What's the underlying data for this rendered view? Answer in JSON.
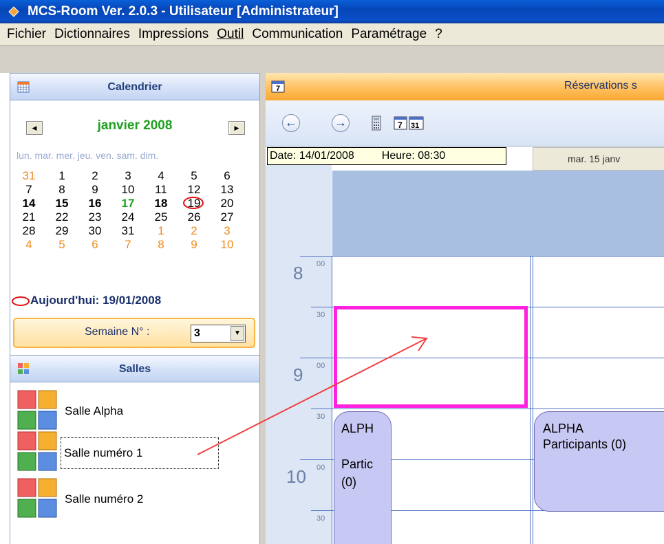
{
  "window": {
    "title": "MCS-Room Ver. 2.0.3 - Utilisateur [Administrateur]"
  },
  "menu": [
    "Fichier",
    "Dictionnaires",
    "Impressions",
    "Outil",
    "Communication",
    "Paramétrage",
    "?"
  ],
  "calendar": {
    "header": "Calendrier",
    "month": "janvier 2008",
    "weekdays": "lun. mar. mer. jeu. ven. sam. dim.",
    "weeks": [
      [
        "31",
        "1",
        "2",
        "3",
        "4",
        "5",
        "6"
      ],
      [
        "7",
        "8",
        "9",
        "10",
        "11",
        "12",
        "13"
      ],
      [
        "14",
        "15",
        "16",
        "17",
        "18",
        "19",
        "20"
      ],
      [
        "21",
        "22",
        "23",
        "24",
        "25",
        "26",
        "27"
      ],
      [
        "28",
        "29",
        "30",
        "31",
        "1",
        "2",
        "3"
      ],
      [
        "4",
        "5",
        "6",
        "7",
        "8",
        "9",
        "10"
      ]
    ],
    "today_label": "Aujourd'hui: 19/01/2008",
    "week_label": "Semaine N° :",
    "week_value": "3"
  },
  "rooms": {
    "header": "Salles",
    "items": [
      "Salle Alpha",
      "Salle numéro 1",
      "Salle numéro 2"
    ]
  },
  "schedule": {
    "header": "Réservations s",
    "date": "Date: 14/01/2008",
    "time": "Heure: 08:30",
    "column_day": "mar. 15 janv",
    "hours": [
      "8",
      "9",
      "10"
    ],
    "minute_labels": [
      "00",
      "30"
    ],
    "appointments": [
      {
        "title": "ALPH",
        "body": "Partic (0)"
      },
      {
        "title": "ALPHA",
        "body": "Participants (0)"
      }
    ]
  },
  "colors": {
    "selection": "#ff20e0",
    "arrow": "#f04040",
    "accent": "#0a4fc8"
  }
}
